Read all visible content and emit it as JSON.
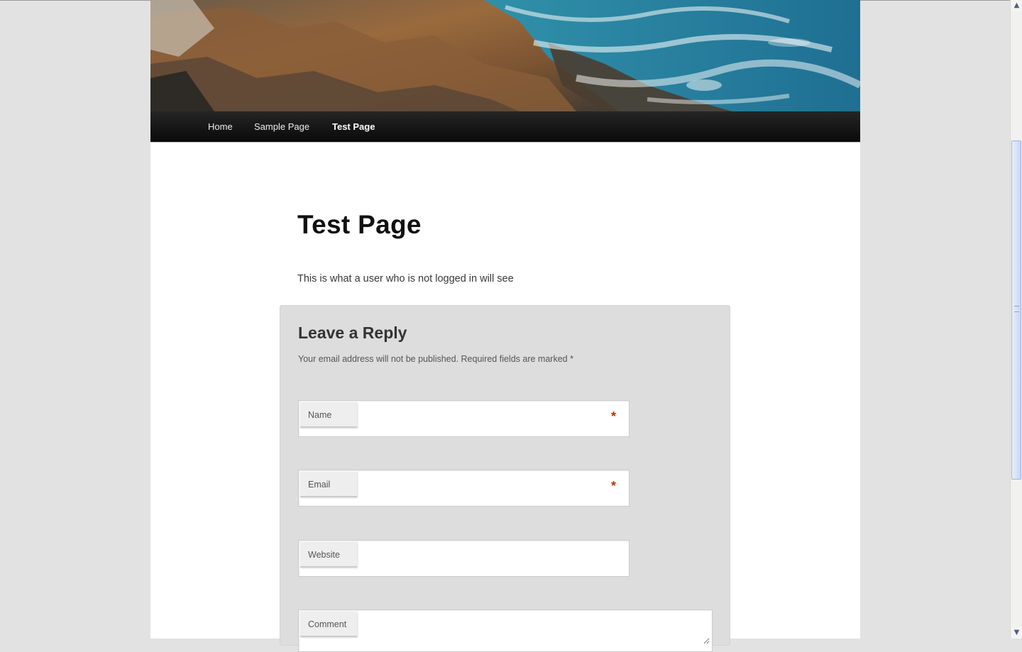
{
  "navigation": {
    "items": [
      {
        "label": "Home",
        "current": false
      },
      {
        "label": "Sample Page",
        "current": false
      },
      {
        "label": "Test Page",
        "current": true
      }
    ]
  },
  "header_image": {
    "alt": "rocky coastline with ocean waves"
  },
  "page": {
    "title": "Test Page",
    "content": "This is what a user who is not logged in will see"
  },
  "comment_form": {
    "title": "Leave a Reply",
    "notes": "Your email address will not be published. Required fields are marked *",
    "fields": [
      {
        "label": "Name",
        "required": true,
        "value": ""
      },
      {
        "label": "Email",
        "required": true,
        "value": ""
      },
      {
        "label": "Website",
        "required": false,
        "value": ""
      },
      {
        "label": "Comment",
        "required": false,
        "value": ""
      }
    ],
    "required_marker": "*"
  },
  "colors": {
    "background": "#e2e2e2",
    "nav": "#111111",
    "form_background": "#dddddd",
    "required": "#bd3500"
  },
  "icons": {
    "scroll_up": "arrow-up-icon",
    "scroll_down": "arrow-down-icon"
  }
}
